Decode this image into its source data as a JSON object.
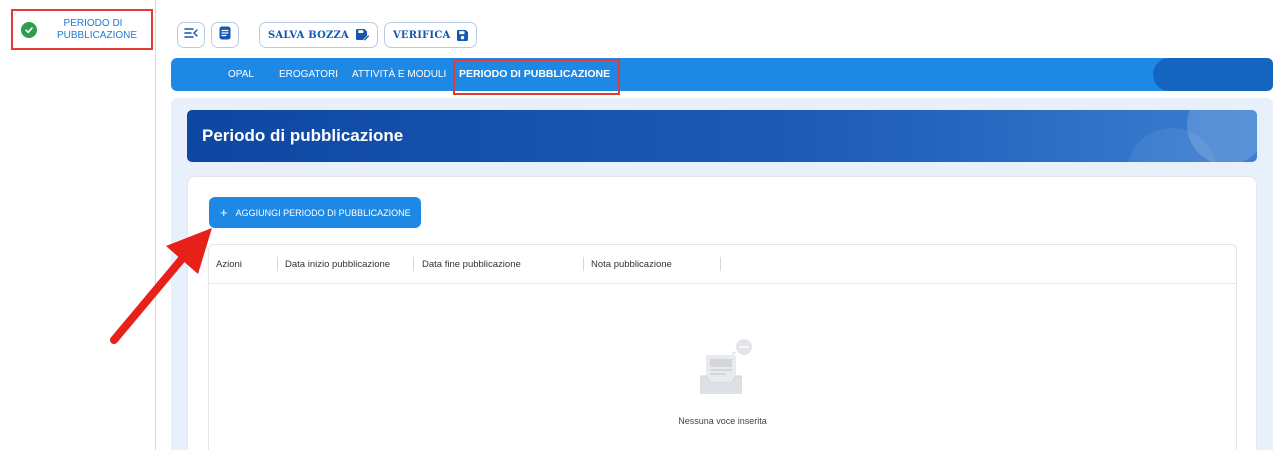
{
  "sidebar": {
    "item_label": "PERIODO DI PUBBLICAZIONE",
    "status_icon": "check-circle-icon"
  },
  "toolbar": {
    "menu_toggle_icon": "menu-collapse-icon",
    "notes_icon": "document-icon",
    "save_draft_label": "SALVA BOZZA",
    "save_draft_icon": "save-edit-icon",
    "verify_label": "VERIFICA",
    "verify_icon": "save-icon"
  },
  "nav": {
    "tabs": [
      {
        "label": "OPAL"
      },
      {
        "label": "EROGATORI"
      },
      {
        "label": "ATTIVITÀ E MODULI"
      },
      {
        "label": "PERIODO DI PUBBLICAZIONE"
      }
    ],
    "active_index": 3
  },
  "main": {
    "title": "Periodo di pubblicazione",
    "add_button_label": "AGGIUNGI PERIODO DI PUBBLICAZIONE",
    "table": {
      "columns": [
        "Azioni",
        "Data inizio pubblicazione",
        "Data fine pubblicazione",
        "Nota pubblicazione"
      ],
      "rows": []
    },
    "empty_message": "Nessuna voce inserita"
  },
  "colors": {
    "accent": "#1e88e5",
    "header_dark": "#0d47a1",
    "highlight": "#e53935",
    "success": "#2e9e4f"
  }
}
